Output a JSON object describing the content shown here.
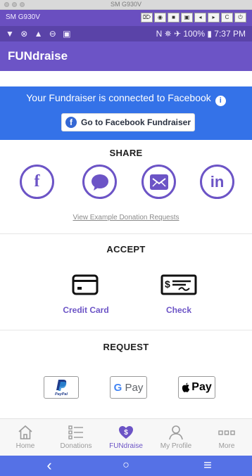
{
  "emulator": {
    "window_title": "SM G930V",
    "device_label": "SM G930V",
    "controls": [
      "⌦",
      "◉",
      "■",
      "▣",
      "◂",
      "▸",
      "C",
      "⏻"
    ]
  },
  "status_bar": {
    "left_icons": "▼ ⊗ ▲ ⊖ ▣",
    "right_text": "N ✵ ✈ 100% ▮ 7:37 PM"
  },
  "header": {
    "title": "FUNdraise"
  },
  "facebook": {
    "message": "Your Fundraiser is connected to Facebook",
    "button_label": "Go to Facebook Fundraiser"
  },
  "share": {
    "heading": "SHARE",
    "link": "View Example Donation Requests",
    "icons": [
      "facebook-icon",
      "messenger-icon",
      "email-icon",
      "linkedin-icon"
    ],
    "facebook_glyph": "f",
    "linkedin_glyph": "in"
  },
  "accept": {
    "heading": "ACCEPT",
    "credit_card_label": "Credit Card",
    "check_label": "Check"
  },
  "request": {
    "heading": "REQUEST",
    "paypal_label": "PayPal",
    "gpay_g": "G",
    "gpay_label": "Pay",
    "applepay_label": "Pay"
  },
  "tabs": [
    {
      "label": "Home",
      "icon": "home-icon",
      "active": false
    },
    {
      "label": "Donations",
      "icon": "list-icon",
      "active": false
    },
    {
      "label": "FUNdraise",
      "icon": "heart-dollar-icon",
      "active": true
    },
    {
      "label": "My Profile",
      "icon": "profile-icon",
      "active": false
    },
    {
      "label": "More",
      "icon": "more-icon",
      "active": false
    }
  ],
  "nav_bar": {
    "back": "‹",
    "home": "○",
    "menu": "≡"
  },
  "colors": {
    "brand_purple": "#6c54c6",
    "facebook_blue": "#3472e8",
    "nav_blue": "#5571e6"
  }
}
